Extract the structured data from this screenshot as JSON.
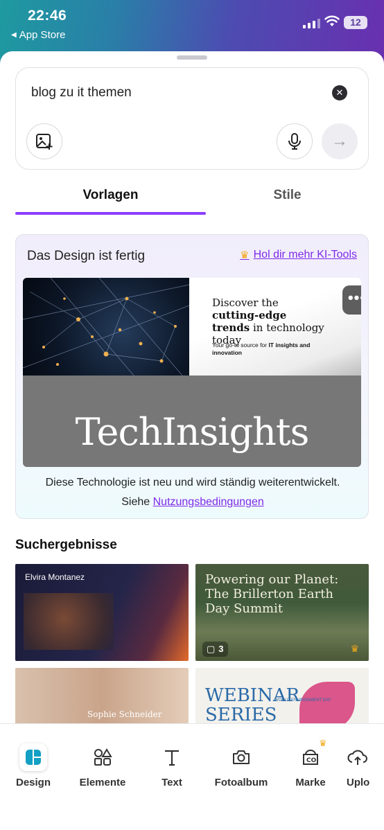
{
  "status_bar": {
    "time": "22:46",
    "back_label": "App Store",
    "battery": "12"
  },
  "prompt": {
    "query": "blog zu it themen"
  },
  "tabs": [
    {
      "label": "Vorlagen"
    },
    {
      "label": "Stile"
    }
  ],
  "result": {
    "title": "Das Design ist fertig",
    "upsell_link": "Hol dir mehr KI-Tools",
    "design": {
      "headline_plain_1": "Discover the ",
      "headline_bold_1": "cutting-edge trends",
      "headline_plain_2": " in technology today",
      "sub_plain": "Your go-to source for ",
      "sub_bold": "IT insights and innovation",
      "brand": "TechInsights"
    },
    "disclaimer": "Diese Technologie ist neu und wird ständig weiterentwickelt.",
    "terms_prefix": "Siehe ",
    "terms_link": "Nutzungsbedingungen"
  },
  "search_results": {
    "title": "Suchergebnisse",
    "thumbs": {
      "t1_name": "Elvira Montanez",
      "t2_title": "Powering our Planet: The Brillerton Earth Day Summit",
      "t2_pages": "3",
      "t3_name": "Sophie Schneider",
      "t4_title": "WEBINAR SERIES",
      "t4_sub": "WORLD ENVIRONMENT DAY"
    }
  },
  "bottom_nav": [
    {
      "label": "Design",
      "icon": "design-icon"
    },
    {
      "label": "Elemente",
      "icon": "shapes-icon"
    },
    {
      "label": "Text",
      "icon": "text-icon"
    },
    {
      "label": "Fotoalbum",
      "icon": "camera-icon"
    },
    {
      "label": "Marke",
      "icon": "brand-icon"
    },
    {
      "label": "Uplo",
      "icon": "cloud-upload-icon"
    }
  ],
  "colors": {
    "accent": "#8b3dff",
    "link": "#7d2ae8",
    "crown": "#f1a81a"
  }
}
